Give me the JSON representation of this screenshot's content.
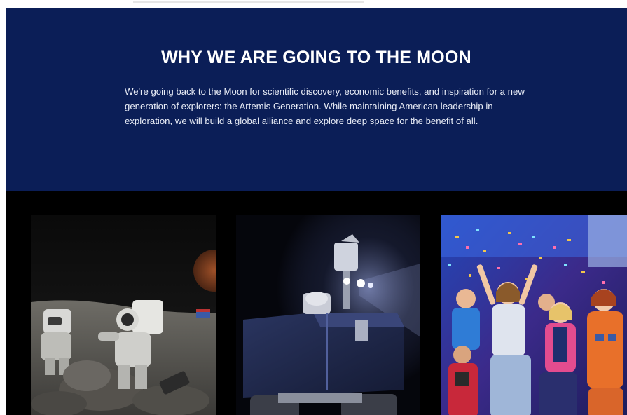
{
  "hero": {
    "title": "WHY WE ARE GOING TO THE MOON",
    "body": "We're going back to the Moon for scientific discovery, economic benefits, and inspiration for a new generation of explorers: the Artemis Generation. While maintaining American leadership in exploration, we will build a global alliance and explore deep space for the benefit of all."
  },
  "colors": {
    "hero_background": "#0b1e57",
    "band_background": "#000000",
    "text": "#ffffff"
  },
  "images": [
    {
      "name": "astronauts-on-moon-image"
    },
    {
      "name": "viper-rover-image"
    },
    {
      "name": "artemis-generation-kids-image"
    }
  ]
}
